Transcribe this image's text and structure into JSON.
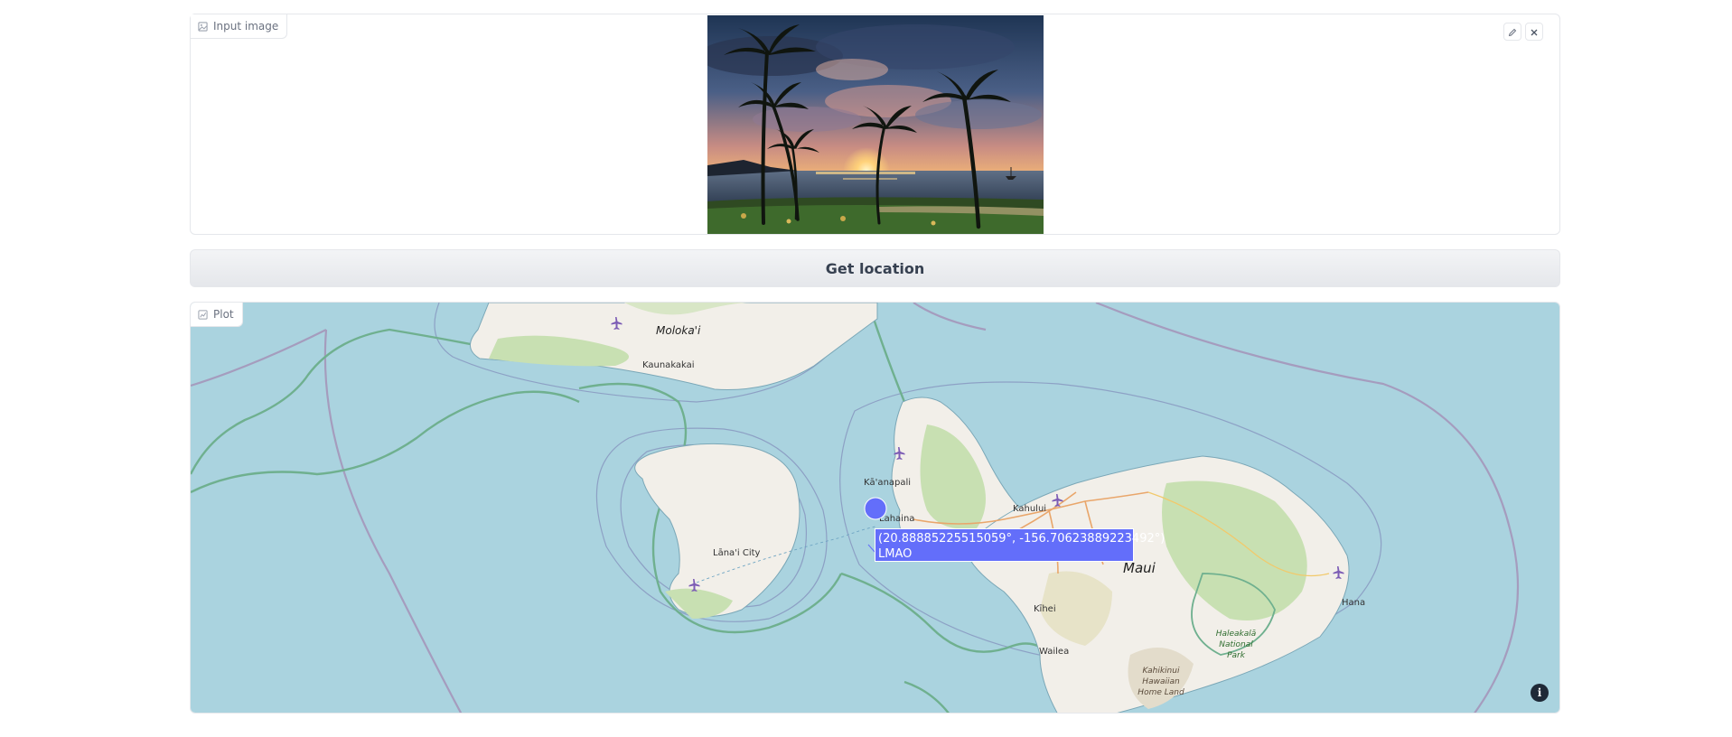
{
  "input_panel": {
    "label": "Input image",
    "label_icon": "image-icon"
  },
  "controls": {
    "edit_icon": "pencil-icon",
    "clear_icon": "close-icon"
  },
  "submit": {
    "label": "Get location"
  },
  "plot_panel": {
    "label": "Plot",
    "label_icon": "chart-icon"
  },
  "map": {
    "places": {
      "molokai": "Moloka'i",
      "kaunakakai": "Kaunakakai",
      "kaanapali": "Kā'anapali",
      "lahaina": "Lahaina",
      "kahului": "Kahului",
      "lanai_city": "Lāna'i City",
      "maui": "Maui",
      "kihei": "Kīhei",
      "wailea": "Wailea",
      "hana": "Hana",
      "haleakala_1": "Haleakalā",
      "haleakala_2": "National",
      "haleakala_3": "Park",
      "kahikinui_1": "Kahikinui",
      "kahikinui_2": "Hawaiian",
      "kahikinui_3": "Home Land"
    },
    "marker": {
      "coordinates": "(20.88885225515059°, -156.70623889223492°)",
      "name": "LMAO",
      "color": "#636efa"
    },
    "colors": {
      "water": "#aad3df",
      "land": "#f2efe9",
      "forest": "#c8e0b2",
      "marker": "#636efa"
    },
    "info_icon": "info-icon",
    "info_glyph": "i"
  }
}
